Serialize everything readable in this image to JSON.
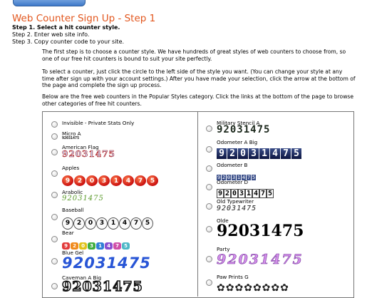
{
  "page": {
    "title": "Web Counter Sign Up - Step 1",
    "steps": [
      "Step 1. Select a hit counter style.",
      "Step 2. Enter web site info.",
      "Step 3. Copy counter code to your site."
    ],
    "paragraphs": [
      "The first step is to choose a counter style. We have hundreds of great styles of web counters to choose from, so one of our free hit counters is bound to suit your site perfectly.",
      "To select a counter, just click the circle to the left side of the style you want. (You can change your style at any time after sign up with your account settings.) After you have made your selection, click the arrow at the bottom of the page and complete the sign up process.",
      "Below are the free web counters in the Popular Styles category. Click the links at the bottom of the page to browse other categories of free hit counters."
    ]
  },
  "counters_left": [
    {
      "label": "Invisible - Private Stats Only",
      "sample": ""
    },
    {
      "label": "Micro A",
      "sample": "92031475"
    },
    {
      "label": "American Flag",
      "sample": "92031475"
    },
    {
      "label": "Apples",
      "sample": "92031475"
    },
    {
      "label": "Arabolic",
      "sample": "92031475"
    },
    {
      "label": "Baseball",
      "sample": "92031475"
    },
    {
      "label": "Bear",
      "sample": "92031475"
    },
    {
      "label": "Blue Gel",
      "sample": "92031475"
    },
    {
      "label": "Caveman A Big",
      "sample": "92031475"
    }
  ],
  "counters_right": [
    {
      "label": "Military Stencil A",
      "sample": "92031475"
    },
    {
      "label": "Odometer A Big",
      "sample": "92031475"
    },
    {
      "label": "Odometer B",
      "sample": "92031475"
    },
    {
      "label": "Odometer D",
      "sample": "92031475"
    },
    {
      "label": "Old Typewriter",
      "sample": "92031475"
    },
    {
      "label": "Olde",
      "sample": "92031475"
    },
    {
      "label": "Party",
      "sample": "92031475"
    },
    {
      "label": "Paw Prints G",
      "sample": "92031475"
    }
  ],
  "colors": {
    "title": "#e2561d",
    "bear_digits": [
      "#e23b3b",
      "#f08a1c",
      "#e0c21a",
      "#3fae3f",
      "#2f7fd6",
      "#8a4fd0",
      "#d04fa8",
      "#4fb8c8"
    ]
  }
}
